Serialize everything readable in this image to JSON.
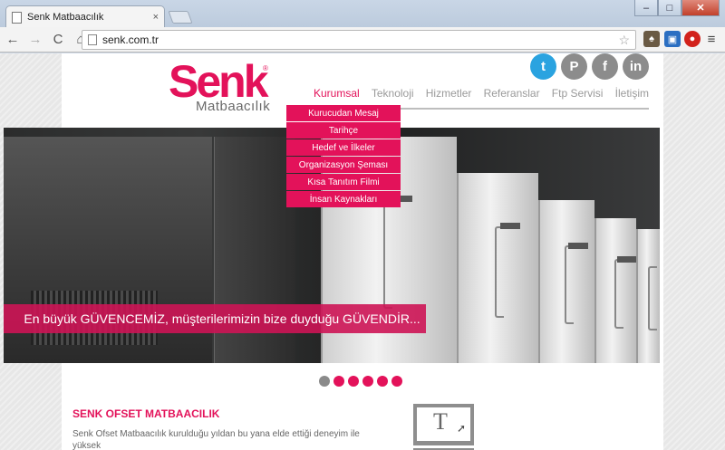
{
  "browser": {
    "tab_title": "Senk Matbaacılık",
    "tab_close": "×",
    "url": "senk.com.tr",
    "window_controls": {
      "minimize": "–",
      "maximize": "□",
      "close": "✕"
    },
    "nav": {
      "back": "←",
      "forward": "→",
      "reload": "C",
      "home": "⌂"
    },
    "bookmark_icon": "star-icon",
    "menu": "≡"
  },
  "site": {
    "logo_text": "Senk",
    "logo_reg": "®",
    "logo_sub": "Matbaacılık",
    "social": [
      {
        "name": "twitter",
        "glyph": "t",
        "color": "#2aa3e0"
      },
      {
        "name": "pinterest",
        "glyph": "P",
        "color": "#8c8c8c"
      },
      {
        "name": "facebook",
        "glyph": "f",
        "color": "#8c8c8c"
      },
      {
        "name": "linkedin",
        "glyph": "in",
        "color": "#8c8c8c"
      }
    ],
    "nav": [
      "Kurumsal",
      "Teknoloji",
      "Hizmetler",
      "Referanslar",
      "Ftp Servisi",
      "İletişim"
    ],
    "dropdown": [
      "Kurucudan Mesaj",
      "Tarihçe",
      "Hedef ve İlkeler",
      "Organizasyon Şeması",
      "Kısa Tanıtım Filmi",
      "İnsan Kaynakları"
    ],
    "hero_banner": "En büyük GÜVENCEMİZ, müşterilerimizin bize duyduğu GÜVENDİR...",
    "slider_dots": 6,
    "section_title": "SENK OFSET MATBAACILIK",
    "section_text": "Senk Ofset Matbaacılık kurulduğu yıldan bu yana elde ettiği deneyim ile yüksek",
    "colors": {
      "brand": "#e3125a",
      "gray": "#8c8c8c"
    }
  }
}
